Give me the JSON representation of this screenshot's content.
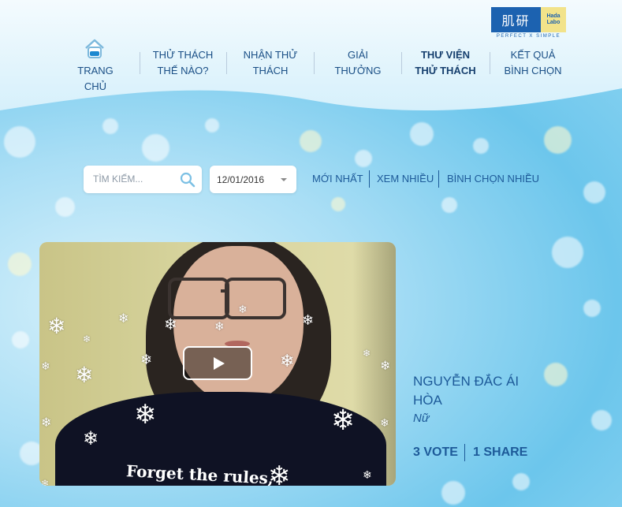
{
  "brand": {
    "logo_text": "肌研",
    "logo_sub_1": "Hada",
    "logo_sub_2": "Labo",
    "tagline": "PERFECT X SIMPLE"
  },
  "nav": {
    "items": [
      {
        "label_1": "TRANG CHỦ",
        "label_2": ""
      },
      {
        "label_1": "THỬ THÁCH",
        "label_2": "THẾ NÀO?"
      },
      {
        "label_1": "NHẬN THỬ",
        "label_2": "THÁCH"
      },
      {
        "label_1": "GIẢI",
        "label_2": "THƯỞNG"
      },
      {
        "label_1": "THƯ VIỆN",
        "label_2": "THỬ THÁCH"
      },
      {
        "label_1": "KẾT QUẢ",
        "label_2": "BÌNH CHỌN"
      }
    ],
    "active_index": 4
  },
  "search": {
    "placeholder": "TÌM KIẾM..."
  },
  "date_filter": {
    "value": "12/01/2016"
  },
  "sort_filters": [
    "MỚI NHẤT",
    "XEM NHIỀU",
    "BÌNH CHỌN NHIỀU"
  ],
  "video": {
    "shirt_text": "Forget the rules,"
  },
  "entry": {
    "name_line_1": "NGUYỄN ĐẮC ÁI",
    "name_line_2": "HÒA",
    "gender": "Nữ",
    "votes": "3 VOTE",
    "shares": "1 SHARE"
  },
  "colors": {
    "primary": "#1d5a99",
    "logo_blue": "#1c62b0",
    "logo_yellow": "#f2e38a"
  }
}
